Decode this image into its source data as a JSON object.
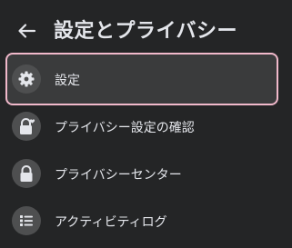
{
  "header": {
    "title": "設定とプライバシー",
    "back_icon": "arrow-left-icon"
  },
  "menu": {
    "items": [
      {
        "label": "設定",
        "icon": "gear-icon",
        "selected": true
      },
      {
        "label": "プライバシー設定の確認",
        "icon": "lock-heart-icon",
        "selected": false
      },
      {
        "label": "プライバシーセンター",
        "icon": "lock-icon",
        "selected": false
      },
      {
        "label": "アクティビティログ",
        "icon": "list-icon",
        "selected": false
      }
    ]
  },
  "colors": {
    "background": "#242526",
    "selected_background": "#3a3b3c",
    "selected_outline": "#f1b9cb",
    "icon_circle": "#4e4f50",
    "text": "#e4e6eb"
  }
}
